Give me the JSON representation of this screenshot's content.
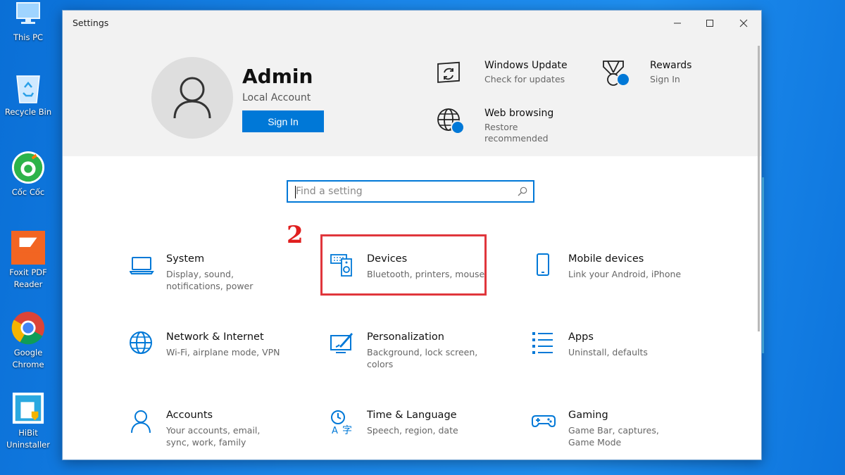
{
  "desktop": {
    "icons": [
      {
        "label": "This PC"
      },
      {
        "label": "Recycle Bin"
      },
      {
        "label": "Cốc Cốc"
      },
      {
        "label": "Foxit PDF\nReader"
      },
      {
        "label": "Google\nChrome"
      },
      {
        "label": "HiBit\nUninstaller"
      }
    ]
  },
  "window": {
    "title": "Settings",
    "controls": {
      "minimize": "—",
      "maximize": "☐",
      "close": "✕"
    }
  },
  "account": {
    "name": "Admin",
    "type": "Local Account",
    "sign_in_label": "Sign In"
  },
  "header_tiles": [
    {
      "title": "Windows Update",
      "subtitle": "Check for updates",
      "icon": "sync-icon"
    },
    {
      "title": "Rewards",
      "subtitle": "Sign In",
      "icon": "trophy-icon"
    },
    {
      "title": "Web browsing",
      "subtitle": "Restore recommended",
      "icon": "globe-icon"
    }
  ],
  "search": {
    "placeholder": "Find a setting"
  },
  "annotation": {
    "step_number": "2"
  },
  "categories": [
    {
      "title": "System",
      "subtitle": "Display, sound, notifications, power",
      "icon": "laptop-icon"
    },
    {
      "title": "Devices",
      "subtitle": "Bluetooth, printers, mouse",
      "icon": "devices-icon"
    },
    {
      "title": "Mobile devices",
      "subtitle": "Link your Android, iPhone",
      "icon": "phone-icon"
    },
    {
      "title": "Network & Internet",
      "subtitle": "Wi-Fi, airplane mode, VPN",
      "icon": "globe-icon"
    },
    {
      "title": "Personalization",
      "subtitle": "Background, lock screen, colors",
      "icon": "paint-icon"
    },
    {
      "title": "Apps",
      "subtitle": "Uninstall, defaults",
      "icon": "apps-list-icon"
    },
    {
      "title": "Accounts",
      "subtitle": "Your accounts, email, sync, work, family",
      "icon": "person-icon"
    },
    {
      "title": "Time & Language",
      "subtitle": "Speech, region, date",
      "icon": "time-language-icon"
    },
    {
      "title": "Gaming",
      "subtitle": "Game Bar, captures, Game Mode",
      "icon": "gamepad-icon"
    }
  ],
  "colors": {
    "accent": "#0078d7",
    "annotation_red": "#e0363c",
    "desktop_blue": "#1a86ea"
  }
}
